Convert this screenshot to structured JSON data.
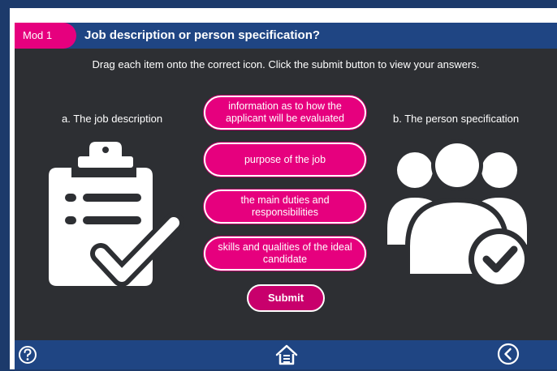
{
  "header": {
    "module_label": "Mod 1",
    "title": "Job description or person specification?"
  },
  "instruction": "Drag each item onto the correct icon. Click the submit button to view your answers.",
  "targets": [
    {
      "label": "a. The job description",
      "icon": "clipboard-check-icon"
    },
    {
      "label": "b. The person specification",
      "icon": "user-group-check-icon"
    }
  ],
  "drag_items": [
    {
      "label": "information as to how the applicant will be evaluated"
    },
    {
      "label": "purpose of the job"
    },
    {
      "label": "the main duties and responsibilities"
    },
    {
      "label": "skills and qualities of the ideal candidate"
    }
  ],
  "submit_label": "Submit",
  "footer": {
    "help_icon": "help-icon",
    "home_icon": "home-icon",
    "back_icon": "back-icon"
  },
  "colors": {
    "accent": "#e6007e",
    "header": "#1f4583",
    "stage": "#2d2f33",
    "frame": "#1c3a6b"
  }
}
